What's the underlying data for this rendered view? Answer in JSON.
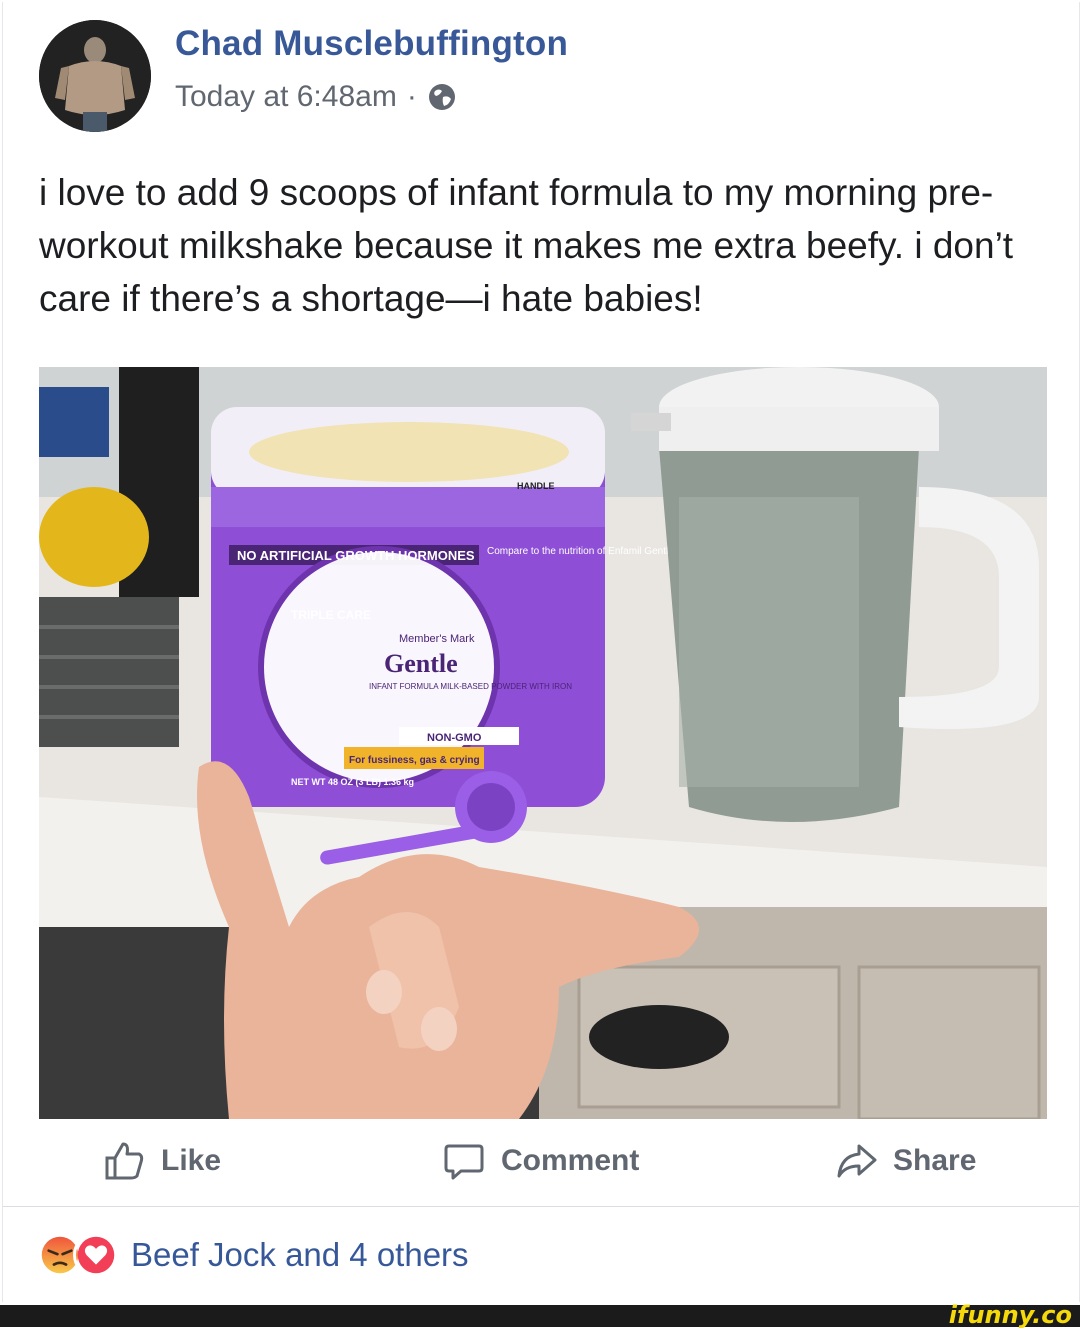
{
  "post": {
    "author": "Chad Musclebuffington",
    "time": "Today at 6:48am",
    "separator": "·",
    "text": "i love to add 9 scoops of infant formula to my morning pre-workout milkshake because it makes me extra beefy. i don’t care if there’s a shortage—i hate babies!",
    "photo": {
      "label_banner": "NO ARTIFICIAL GROWTH HORMONES",
      "compare": "Compare to the nutrition of Enfamil Gentlease",
      "triple_care": "TRIPLE CARE",
      "brand": "Member's Mark",
      "product": "Gentle",
      "product_sub": "INFANT FORMULA MILK-BASED POWDER WITH IRON",
      "fussiness": "For fussiness, gas & crying",
      "non_gmo": "NON-GMO",
      "net_wt": "NET WT 48 OZ (3 LB) 1.36 kg",
      "handle": "HANDLE"
    }
  },
  "actions": {
    "like": "Like",
    "comment": "Comment",
    "share": "Share"
  },
  "reactions": {
    "text": "Beef Jock and 4 others",
    "icons": [
      "angry-icon",
      "love-icon"
    ]
  },
  "watermark": "ifunny.co",
  "colors": {
    "author": "#385898",
    "meta": "#616770",
    "action": "#606770",
    "formula_purple": "#8e4fd6",
    "watermark": "#f5d90a"
  }
}
